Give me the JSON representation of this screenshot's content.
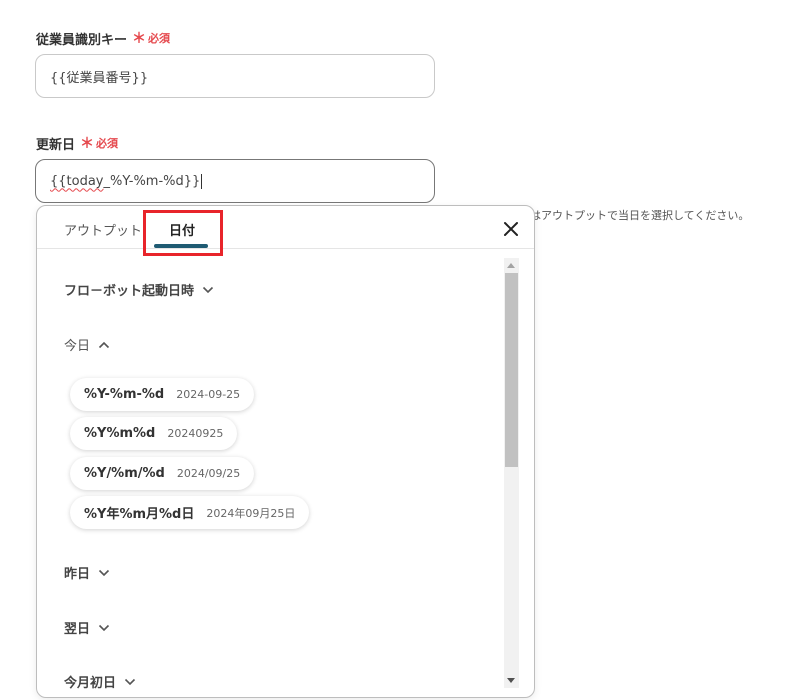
{
  "fields": [
    {
      "label": "従業員識別キー",
      "required_mark": "＊",
      "required_text": "必須",
      "value": "{{従業員番号}}"
    },
    {
      "label": "更新日",
      "required_mark": "＊",
      "required_text": "必須",
      "value_underlined": "{{today",
      "value_rest": "_%Y-%m-%d}}"
    }
  ],
  "helper_text": "はアウトプットで当日を選択してください。",
  "popup": {
    "tabs": [
      {
        "label": "アウトプット",
        "active": false
      },
      {
        "label": "日付",
        "active": true
      }
    ],
    "sections": [
      {
        "label": "フロ－ボット起動日時",
        "expanded": false
      },
      {
        "label": "今日",
        "expanded": true
      },
      {
        "label": "昨日",
        "expanded": false
      },
      {
        "label": "翌日",
        "expanded": false
      },
      {
        "label": "今月初日",
        "expanded": false
      }
    ],
    "today_options": [
      {
        "format": "%Y-%m-%d",
        "example": "2024-09-25"
      },
      {
        "format": "%Y%m%d",
        "example": "20240925"
      },
      {
        "format": "%Y/%m/%d",
        "example": "2024/09/25"
      },
      {
        "format": "%Y年%m月%d日",
        "example": "2024年09月25日"
      }
    ]
  },
  "colors": {
    "required": "#e5484d",
    "tab_underline": "#1f5b73",
    "highlight": "#e8242a"
  }
}
